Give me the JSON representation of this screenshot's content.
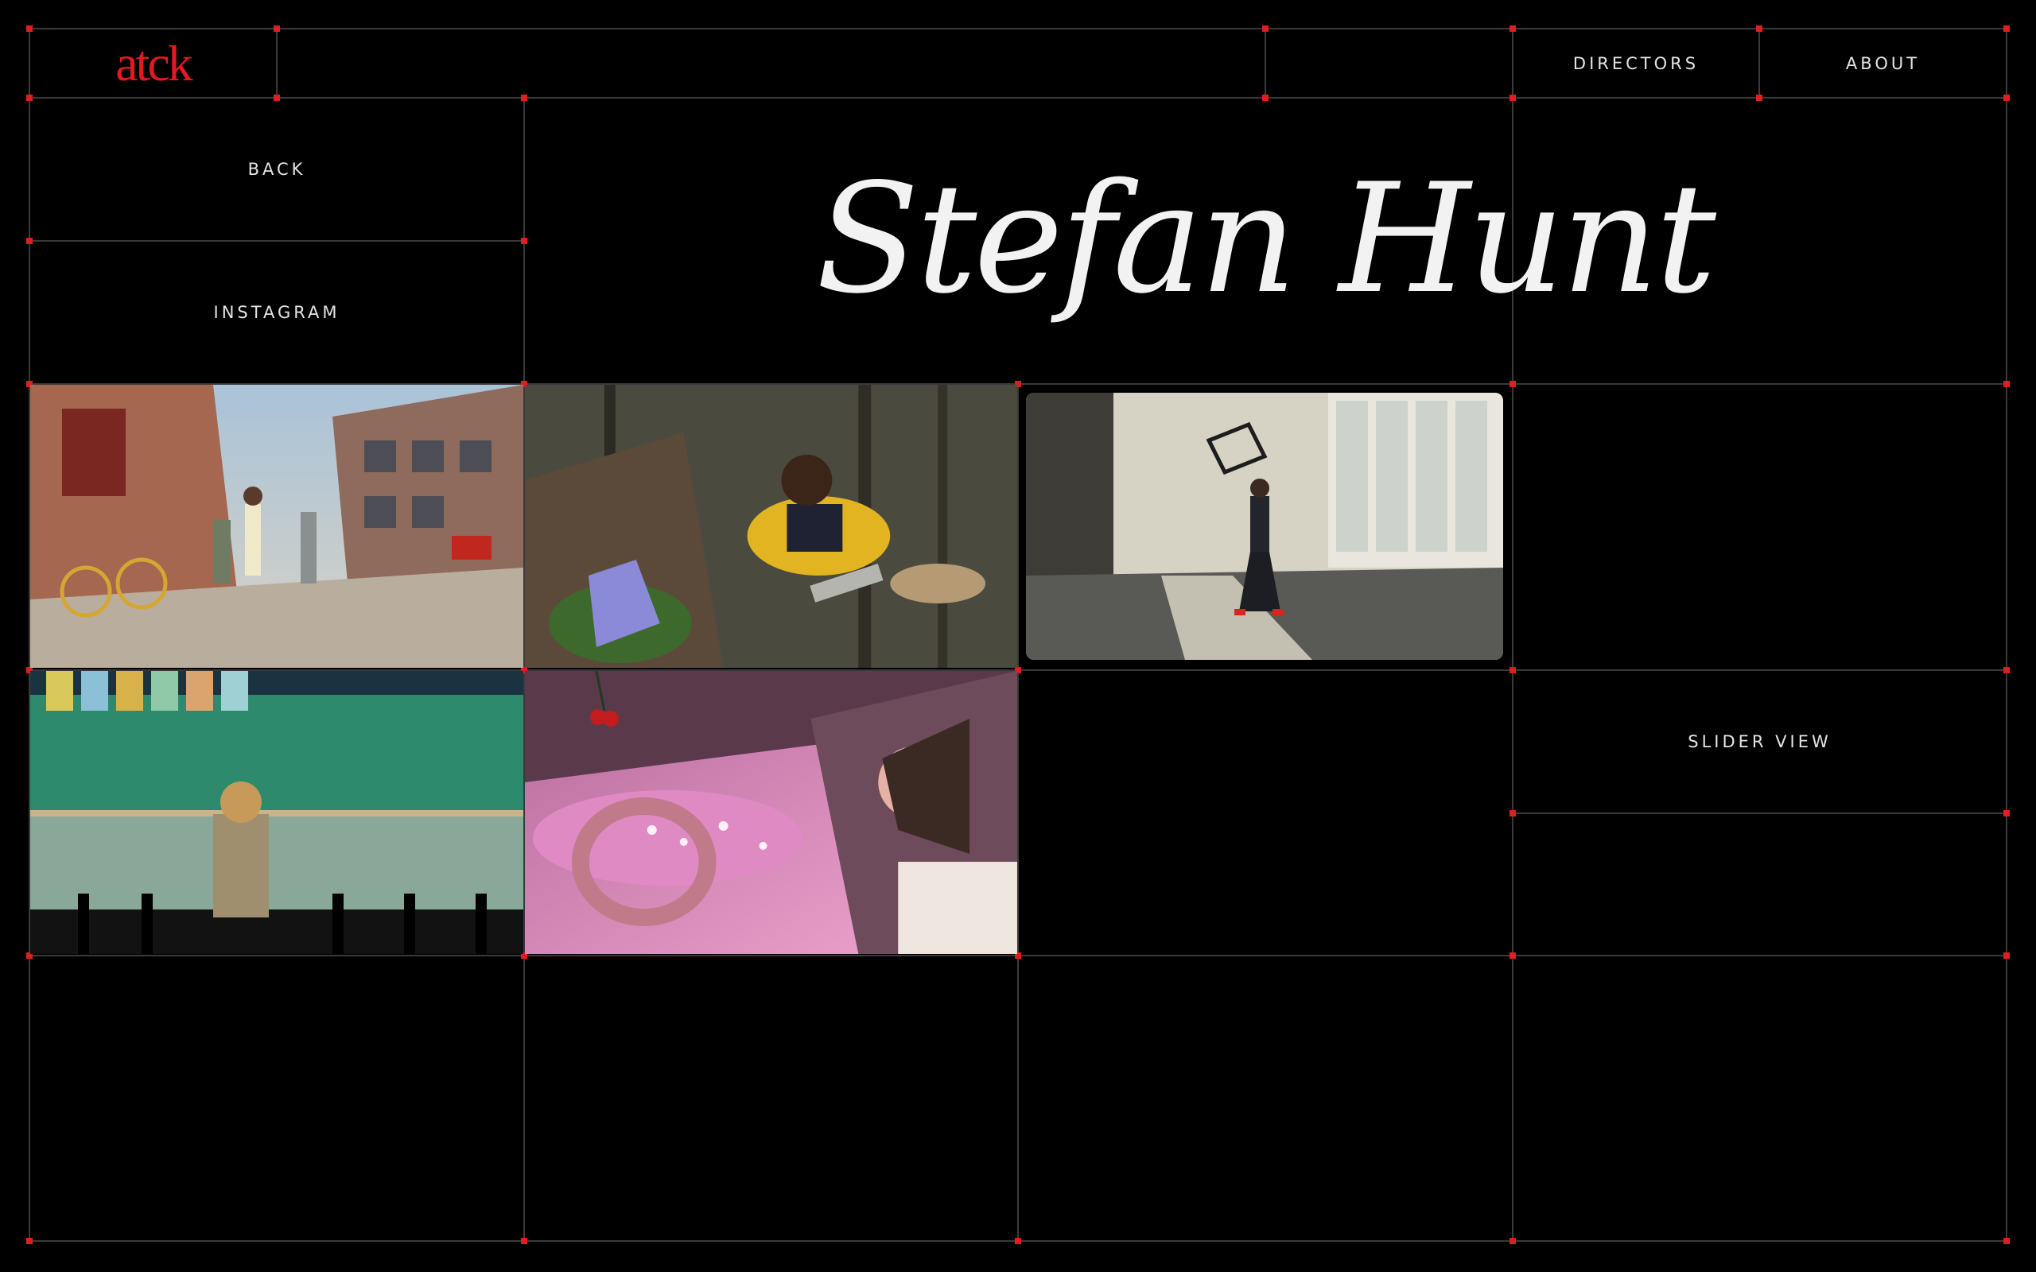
{
  "header": {
    "logo_text": "atck",
    "nav": [
      {
        "label": "DIRECTORS"
      },
      {
        "label": "ABOUT"
      }
    ]
  },
  "sidebar": {
    "back_label": "BACK",
    "instagram_label": "INSTAGRAM"
  },
  "director": {
    "name": "Stefan Hunt"
  },
  "controls": {
    "slider_view_label": "SLIDER VIEW"
  },
  "colors": {
    "accent": "#e01e1e",
    "grid_line": "#3a3a3a",
    "background": "#000000",
    "text": "#e6e6e6"
  }
}
